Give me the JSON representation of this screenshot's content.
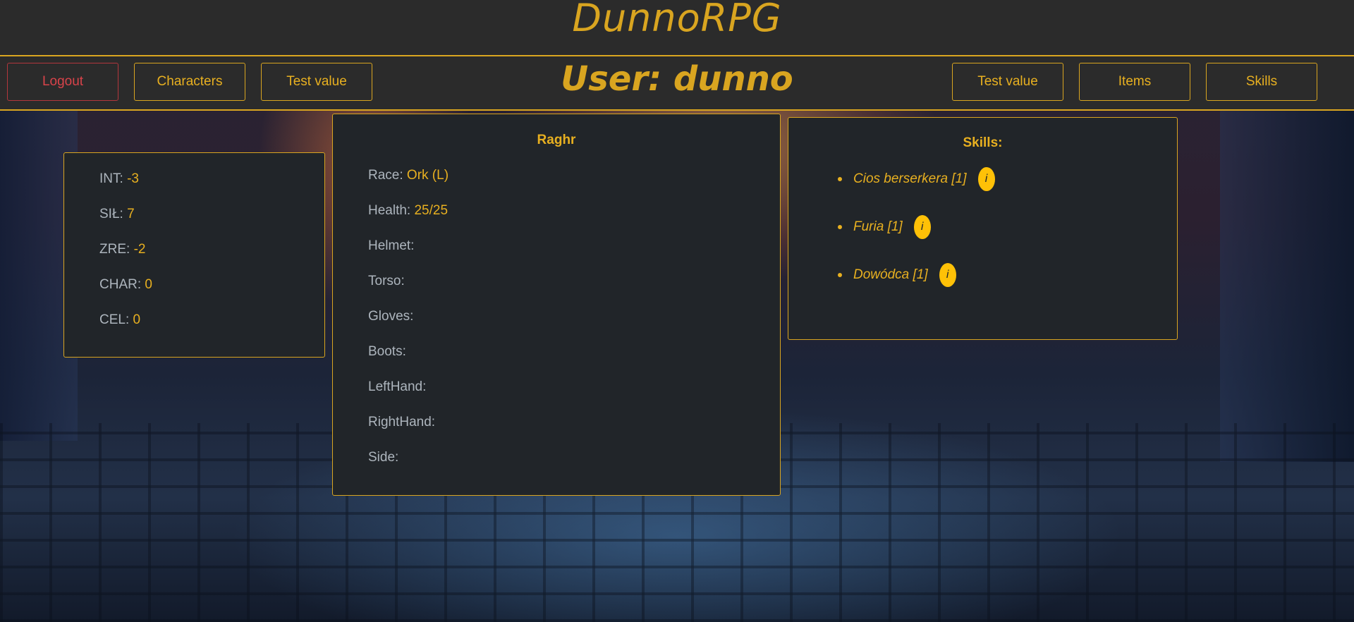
{
  "header": {
    "brand": "DunnoRPG"
  },
  "nav": {
    "logout_label": "Logout",
    "characters_label": "Characters",
    "test_value_left_label": "Test value",
    "user_title": "User: dunno",
    "test_value_right_label": "Test value",
    "items_label": "Items",
    "skills_label": "Skills"
  },
  "stats": [
    {
      "label": "INT:",
      "value": "-3"
    },
    {
      "label": "SIŁ:",
      "value": "7"
    },
    {
      "label": "ZRE:",
      "value": "-2"
    },
    {
      "label": "CHAR:",
      "value": "0"
    },
    {
      "label": "CEL:",
      "value": "0"
    }
  ],
  "character": {
    "name": "Raghr",
    "race_label": "Race:",
    "race_value": "Ork (L)",
    "health_label": "Health:",
    "health_value": "25/25",
    "equipment": [
      {
        "label": "Helmet:"
      },
      {
        "label": "Torso:"
      },
      {
        "label": "Gloves:"
      },
      {
        "label": "Boots:"
      },
      {
        "label": "LeftHand:"
      },
      {
        "label": "RightHand:"
      },
      {
        "label": "Side:"
      }
    ]
  },
  "skills": {
    "title": "Skills:",
    "items": [
      {
        "name": "Cios berserkera [1]",
        "info": "i"
      },
      {
        "name": "Furia [1]",
        "info": "i"
      },
      {
        "name": "Dowódca [1]",
        "info": "i"
      }
    ]
  },
  "colors": {
    "accent": "#d9a520",
    "danger": "#d9434a",
    "card_bg": "#212529",
    "header_bg": "#2b2b2b",
    "badge": "#ffc107"
  }
}
